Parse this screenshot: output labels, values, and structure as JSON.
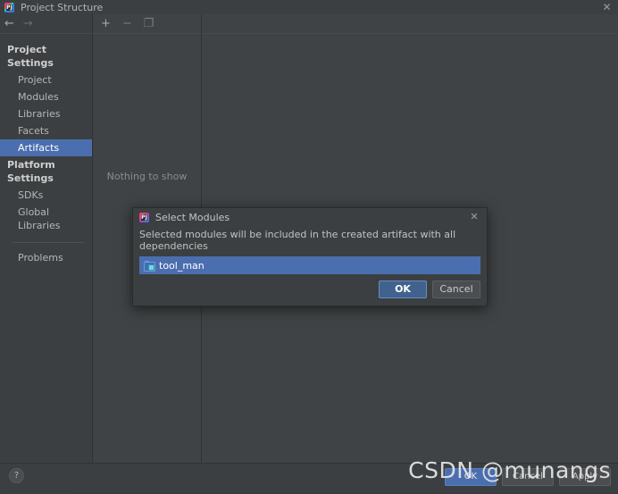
{
  "window": {
    "title": "Project Structure",
    "app_icon": "pycharm-icon",
    "icon_text": "PJ",
    "close_icon": "✕"
  },
  "nav": {
    "back_icon": "←",
    "forward_icon": "→"
  },
  "sidebar": {
    "groups": [
      {
        "header": "Project Settings",
        "items": [
          {
            "label": "Project",
            "selected": false
          },
          {
            "label": "Modules",
            "selected": false
          },
          {
            "label": "Libraries",
            "selected": false
          },
          {
            "label": "Facets",
            "selected": false
          },
          {
            "label": "Artifacts",
            "selected": true
          }
        ]
      },
      {
        "header": "Platform Settings",
        "items": [
          {
            "label": "SDKs",
            "selected": false
          },
          {
            "label": "Global Libraries",
            "selected": false
          }
        ]
      }
    ],
    "problems": "Problems"
  },
  "center_panel": {
    "toolbar": {
      "add_icon": "+",
      "remove_icon": "−",
      "copy_icon": "❐"
    },
    "empty_text": "Nothing to show"
  },
  "dialog": {
    "icon": "pycharm-icon",
    "icon_text": "PJ",
    "title": "Select Modules",
    "close_icon": "✕",
    "description": "Selected modules will be included in the created artifact with all dependencies",
    "modules": [
      {
        "name": "tool_man",
        "icon": "module-folder-icon",
        "selected": true
      }
    ],
    "ok_label": "OK",
    "cancel_label": "Cancel"
  },
  "footer": {
    "help_icon": "?",
    "ok_label": "OK",
    "cancel_label": "Cancel",
    "apply_label": "Apply",
    "hairline_text": "················································"
  },
  "watermark": {
    "text": "CSDN @munangs"
  },
  "colors": {
    "window_bg": "#3c3f41",
    "panel_bg": "#3f4345",
    "selection_blue": "#4b6eaf",
    "primary_button": "#41628f",
    "text": "#bbbbbb"
  }
}
